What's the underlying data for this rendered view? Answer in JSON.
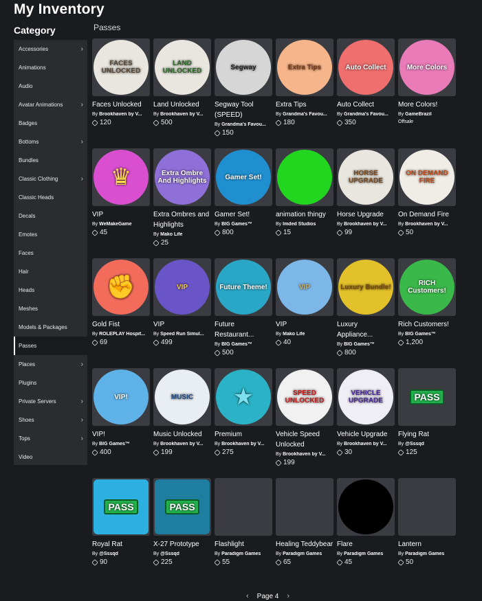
{
  "header": {
    "title": "My Inventory"
  },
  "sidebar": {
    "heading": "Category",
    "items": [
      {
        "label": "Accessories",
        "chevron": true
      },
      {
        "label": "Animations",
        "chevron": false
      },
      {
        "label": "Audio",
        "chevron": false
      },
      {
        "label": "Avatar Animations",
        "chevron": true
      },
      {
        "label": "Badges",
        "chevron": false
      },
      {
        "label": "Bottoms",
        "chevron": true
      },
      {
        "label": "Bundles",
        "chevron": false
      },
      {
        "label": "Classic Clothing",
        "chevron": true
      },
      {
        "label": "Classic Heads",
        "chevron": false
      },
      {
        "label": "Decals",
        "chevron": false
      },
      {
        "label": "Emotes",
        "chevron": false
      },
      {
        "label": "Faces",
        "chevron": false
      },
      {
        "label": "Hair",
        "chevron": false
      },
      {
        "label": "Heads",
        "chevron": false
      },
      {
        "label": "Meshes",
        "chevron": false
      },
      {
        "label": "Models & Packages",
        "chevron": false
      },
      {
        "label": "Passes",
        "chevron": false,
        "active": true
      },
      {
        "label": "Places",
        "chevron": true
      },
      {
        "label": "Plugins",
        "chevron": false
      },
      {
        "label": "Private Servers",
        "chevron": true
      },
      {
        "label": "Shoes",
        "chevron": true
      },
      {
        "label": "Tops",
        "chevron": true
      },
      {
        "label": "Video",
        "chevron": false
      }
    ]
  },
  "main": {
    "section_label": "Passes",
    "items": [
      {
        "name": "Faces Unlocked",
        "creator": "Brookhaven by V...",
        "price": "120",
        "badge_text": "FACES UNLOCKED",
        "bg": "#e9e6df",
        "fg": "#5a4a38"
      },
      {
        "name": "Land Unlocked",
        "creator": "Brookhaven by V...",
        "price": "500",
        "badge_text": "LAND UNLOCKED",
        "bg": "#e9e6df",
        "fg": "#2e6b2a"
      },
      {
        "name": "Segway Tool (SPEED)",
        "creator": "Grandma's Favou...",
        "price": "150",
        "badge_text": "Segway",
        "bg": "#d6d6d6",
        "fg": "#222222"
      },
      {
        "name": "Extra Tips",
        "creator": "Grandma's Favou...",
        "price": "180",
        "badge_text": "Extra Tips",
        "bg": "#f6b58a",
        "fg": "#7a3a1a"
      },
      {
        "name": "Auto Collect",
        "creator": "Grandma's Favou...",
        "price": "350",
        "badge_text": "Auto Collect",
        "bg": "#ef6e6e",
        "fg": "#ffffff"
      },
      {
        "name": "More Colors!",
        "creator": "GameBrazil",
        "price": "",
        "offsale": "Offsale",
        "badge_text": "More Colors",
        "bg": "#e87bb8",
        "fg": "#ffffff"
      },
      {
        "name": "VIP",
        "creator": "WeMakeGame",
        "price": "45",
        "badge_text": "♛",
        "bg": "#d94fd0",
        "fg": "#ffd84a"
      },
      {
        "name": "Extra Ombres and Highlights",
        "creator": "Mako Life",
        "price": "25",
        "badge_text": "Extra Ombre And Highlights",
        "bg": "#8f6fd8",
        "fg": "#ffffff"
      },
      {
        "name": "Gamer Set!",
        "creator": "BIG Games™",
        "price": "800",
        "badge_text": "Gamer Set!",
        "bg": "#1f8fd0",
        "fg": "#ffffff"
      },
      {
        "name": "animation thingy",
        "creator": "Imded Studios",
        "price": "15",
        "badge_text": "",
        "bg": "#22d620",
        "fg": "#ffffff"
      },
      {
        "name": "Horse Upgrade",
        "creator": "Brookhaven by V...",
        "price": "99",
        "badge_text": "HORSE UPGRADE",
        "bg": "#e9e6df",
        "fg": "#7a4a22"
      },
      {
        "name": "On Demand Fire",
        "creator": "Brookhaven by V...",
        "price": "50",
        "badge_text": "ON DEMAND FIRE",
        "bg": "#f0ede6",
        "fg": "#c24a1a"
      },
      {
        "name": "Gold Fist",
        "creator": "ROLEPLAY Hospit...",
        "price": "69",
        "badge_text": "✊",
        "bg": "#f36b5b",
        "fg": "#f3c27a"
      },
      {
        "name": "VIP",
        "creator": "Speed Run Simul...",
        "price": "499",
        "badge_text": "VIP",
        "bg": "#6a55c8",
        "fg": "#ffcc33"
      },
      {
        "name": "Future Restaurant...",
        "creator": "BIG Games™",
        "price": "500",
        "badge_text": "Future Theme!",
        "bg": "#2aa7c6",
        "fg": "#ffffff"
      },
      {
        "name": "VIP",
        "creator": "Mako Life",
        "price": "40",
        "badge_text": "VIP",
        "bg": "#7db7e8",
        "fg": "#d8b04a"
      },
      {
        "name": "Luxury Appliance...",
        "creator": "BIG Games™",
        "price": "800",
        "badge_text": "Luxury Bundle!",
        "bg": "#e2c12a",
        "fg": "#7a4a10"
      },
      {
        "name": "Rich Customers!",
        "creator": "BIG Games™",
        "price": "1,200",
        "badge_text": "RICH Customers!",
        "bg": "#3ab84a",
        "fg": "#ffffff"
      },
      {
        "name": "VIP!",
        "creator": "BIG Games™",
        "price": "400",
        "badge_text": "VIP!",
        "bg": "#5fb2e8",
        "fg": "#ffffff"
      },
      {
        "name": "Music Unlocked",
        "creator": "Brookhaven by V...",
        "price": "199",
        "badge_text": "MUSIC",
        "bg": "#e9eef2",
        "fg": "#1f4f8a"
      },
      {
        "name": "Premium",
        "creator": "Brookhaven by V...",
        "price": "275",
        "badge_text": "★",
        "bg": "#2bb2c6",
        "fg": "#7ee0ee"
      },
      {
        "name": "Vehicle Speed Unlocked",
        "creator": "Brookhaven by V...",
        "price": "199",
        "badge_text": "SPEED UNLOCKED",
        "bg": "#f1f1f1",
        "fg": "#c81a1a"
      },
      {
        "name": "Vehicle Upgrade",
        "creator": "Brookhaven by V...",
        "price": "30",
        "badge_text": "VEHICLE UPGRADE",
        "bg": "#efeef4",
        "fg": "#4b2a9a"
      },
      {
        "name": "Flying Rat",
        "creator": "@Sssqd",
        "price": "125",
        "badge_text": "PASS",
        "bg": "#3a3c42",
        "fg": "#ffffff"
      },
      {
        "name": "Royal Rat",
        "creator": "@Sssqd",
        "price": "90",
        "badge_text": "PASS",
        "bg": "#2bb0e0",
        "fg": "#ffffff"
      },
      {
        "name": "X-27 Prototype",
        "creator": "@Sssqd",
        "price": "225",
        "badge_text": "PASS",
        "bg": "#1f7ea0",
        "fg": "#ffffff"
      },
      {
        "name": "Flashlight",
        "creator": "Paradigm Games",
        "price": "55",
        "badge_text": "",
        "bg": "#3a3c42",
        "fg": "#ffffff"
      },
      {
        "name": "Healing Teddybear",
        "creator": "Paradigm Games",
        "price": "65",
        "badge_text": "",
        "bg": "#3a3c42",
        "fg": "#ffffff"
      },
      {
        "name": "Flare",
        "creator": "Paradigm Games",
        "price": "45",
        "badge_text": "",
        "bg": "#000000",
        "fg": "#ff2a2a"
      },
      {
        "name": "Lantern",
        "creator": "Paradigm Games",
        "price": "50",
        "badge_text": "",
        "bg": "#3a3c42",
        "fg": "#ffffff"
      }
    ]
  },
  "pagination": {
    "label": "Page 4"
  },
  "by_prefix": "By "
}
